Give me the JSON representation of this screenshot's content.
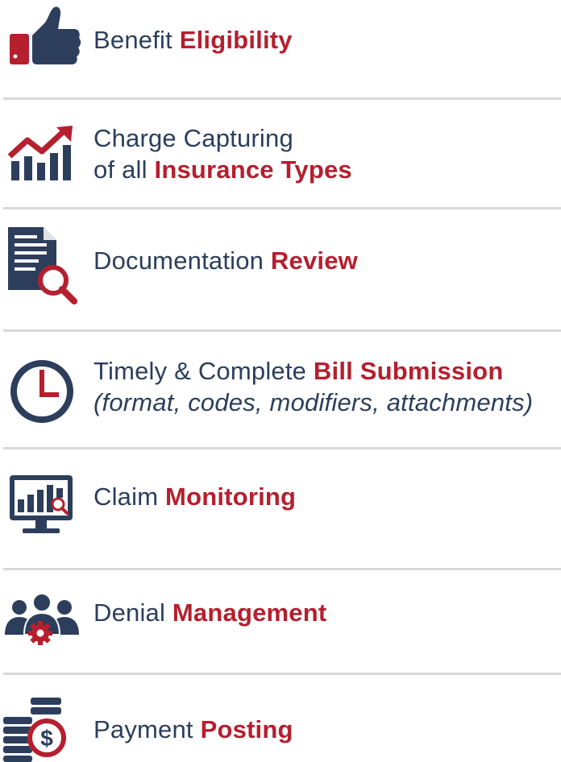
{
  "colors": {
    "navy": "#2c3e5c",
    "red": "#b51f2e",
    "divider": "#d9d9d9"
  },
  "items": [
    {
      "icon": "thumbs-up-icon",
      "plain": "Benefit ",
      "bold": "Eligibility"
    },
    {
      "icon": "trending-chart-icon",
      "line1": "Charge Capturing",
      "plain": "of all ",
      "bold": "Insurance Types"
    },
    {
      "icon": "document-search-icon",
      "plain": "Documentation ",
      "bold": "Review"
    },
    {
      "icon": "clock-icon",
      "plain": "Timely & Complete ",
      "bold": "Bill Submission",
      "subline": "(format, codes, modifiers, attachments)"
    },
    {
      "icon": "monitor-chart-icon",
      "plain": "Claim ",
      "bold": "Monitoring"
    },
    {
      "icon": "team-gear-icon",
      "plain": "Denial ",
      "bold": "Management"
    },
    {
      "icon": "coins-dollar-icon",
      "plain": "Payment ",
      "bold": "Posting"
    }
  ]
}
